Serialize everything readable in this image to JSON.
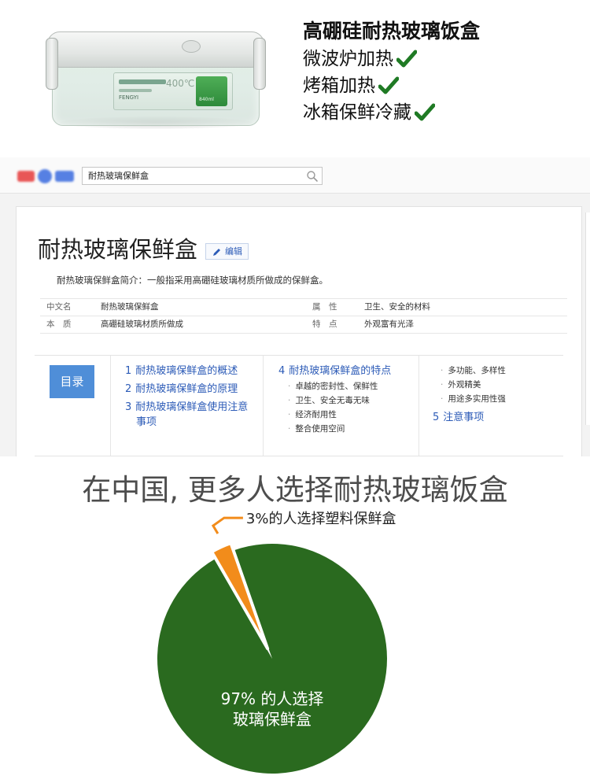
{
  "banner": {
    "title": "高硼硅耐热玻璃饭盒",
    "features": [
      "微波炉加热",
      "烤箱加热",
      "冰箱保鲜冷藏"
    ],
    "check_icon": "check-icon",
    "check_color": "#1f7a24",
    "product_label_brand": "FENGYI",
    "product_label_temp": "400℃",
    "product_label_volume": "840ml"
  },
  "browser": {
    "search_value": "耐热玻璃保鲜盒",
    "search_icon": "search-icon"
  },
  "article": {
    "title": "耐热玻璃保鲜盒",
    "edit_label": "编辑",
    "intro": "耐热玻璃保鲜盒简介：一般指采用高硼硅玻璃材质所做成的保鲜盒。",
    "info_rows": [
      {
        "k1": "中文名",
        "v1": "耐热玻璃保鲜盒",
        "k2": "属　性",
        "v2": "卫生、安全的材料"
      },
      {
        "k1": "本　质",
        "v1": "高硼硅玻璃材质所做成",
        "k2": "特　点",
        "v2": "外观富有光泽"
      }
    ],
    "toc": {
      "button": "目录",
      "col1": [
        {
          "num": "1",
          "label": "耐热玻璃保鲜盒的概述"
        },
        {
          "num": "2",
          "label": "耐热玻璃保鲜盒的原理"
        },
        {
          "num": "3",
          "label": "耐热玻璃保鲜盒使用注意",
          "label2": "事项"
        }
      ],
      "col2_head": {
        "num": "4",
        "label": "耐热玻璃保鲜盒的特点"
      },
      "col2_subs": [
        "卓越的密封性、保鲜性",
        "卫生、安全无毒无味",
        "经济耐用性",
        "整合使用空间"
      ],
      "col3_subs": [
        "多功能、多样性",
        "外观精美",
        "用途多实用性强"
      ],
      "col3_head": {
        "num": "5",
        "label": "注意事项"
      }
    }
  },
  "pie": {
    "headline": "在中国, 更多人选择耐热玻璃饭盒",
    "colors": {
      "major": "#2a6a1f",
      "minor": "#f28c1b",
      "leader": "#f28c1b"
    }
  },
  "chart_data": {
    "type": "pie",
    "title": "在中国, 更多人选择耐热玻璃饭盒",
    "slices": [
      {
        "label": "97% 的人选择玻璃保鲜盒",
        "value": 97,
        "color": "#2a6a1f"
      },
      {
        "label": "3%的人选择塑料保鲜盒",
        "value": 3,
        "color": "#f28c1b"
      }
    ],
    "annotations": [
      "97% 的人选择",
      "玻璃保鲜盒",
      "3%的人选择塑料保鲜盒"
    ]
  }
}
